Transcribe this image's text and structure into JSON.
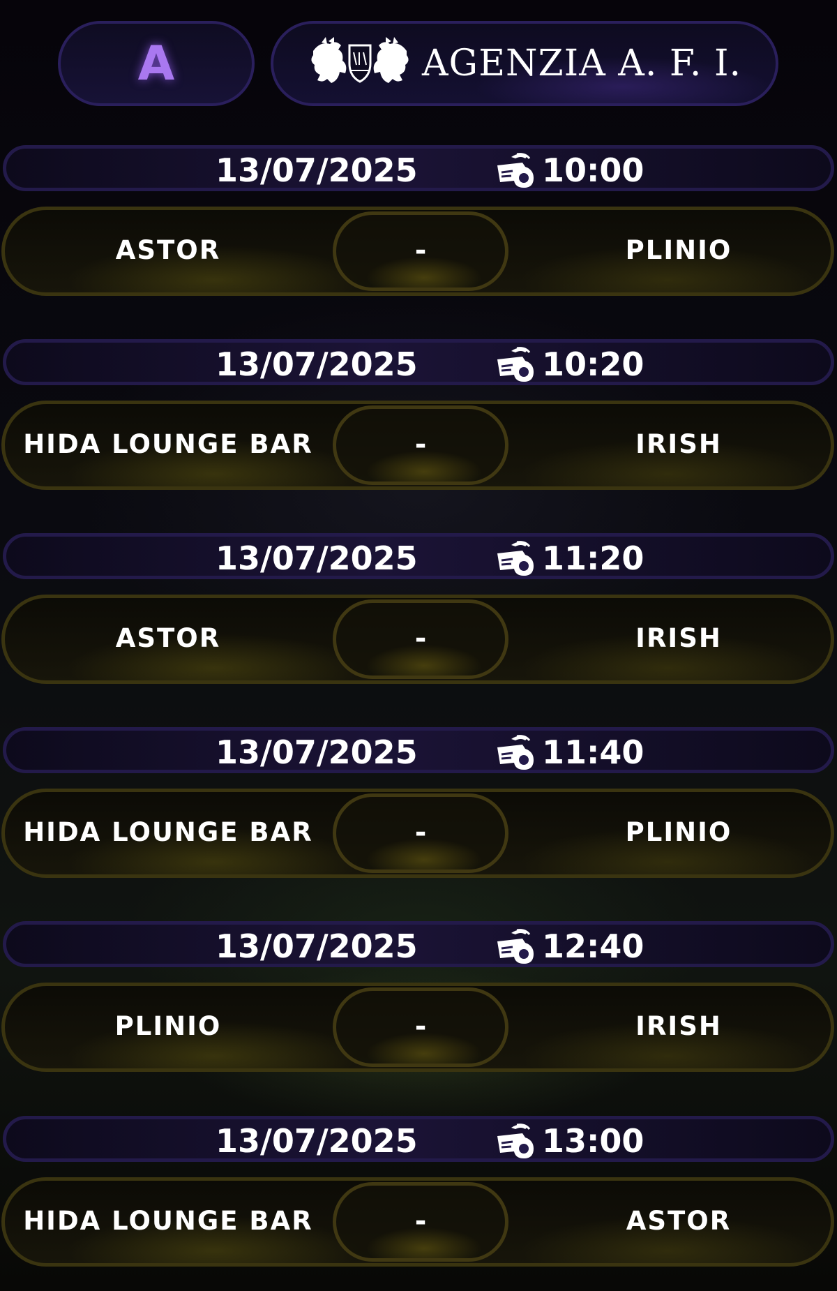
{
  "header": {
    "group_letter": "A",
    "brand_name": "AGENZIA A. F. I.",
    "logo_icon": "griffin-crest-icon"
  },
  "colors": {
    "group_accent": "#a978f0",
    "date_bar_border": "#231a4a",
    "team_bar_border": "#3a3410"
  },
  "matches": [
    {
      "date": "13/07/2025",
      "time": "10:00",
      "home": "ASTOR",
      "score": "-",
      "away": "PLINIO"
    },
    {
      "date": "13/07/2025",
      "time": "10:20",
      "home": "HIDA LOUNGE BAR",
      "score": "-",
      "away": "IRISH"
    },
    {
      "date": "13/07/2025",
      "time": "11:20",
      "home": "ASTOR",
      "score": "-",
      "away": "IRISH"
    },
    {
      "date": "13/07/2025",
      "time": "11:40",
      "home": "HIDA LOUNGE BAR",
      "score": "-",
      "away": "PLINIO"
    },
    {
      "date": "13/07/2025",
      "time": "12:40",
      "home": "PLINIO",
      "score": "-",
      "away": "IRISH"
    },
    {
      "date": "13/07/2025",
      "time": "13:00",
      "home": "HIDA LOUNGE BAR",
      "score": "-",
      "away": "ASTOR"
    }
  ]
}
